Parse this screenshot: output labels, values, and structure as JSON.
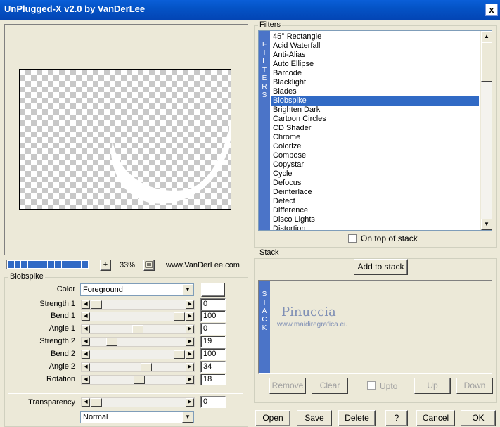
{
  "window": {
    "title": "UnPlugged-X v2.0 by VanDerLee",
    "close_label": "x"
  },
  "preview": {
    "zoom": "33%",
    "website": "www.VanDerLee.com",
    "zoom_in_label": "+",
    "progress_segments": 12
  },
  "filters": {
    "title": "Filters",
    "vertical_tab": [
      "F",
      "I",
      "L",
      "T",
      "E",
      "R",
      "S"
    ],
    "items": [
      "45° Rectangle",
      "Acid Waterfall",
      "Anti-Alias",
      "Auto Ellipse",
      "Barcode",
      "Blacklight",
      "Blades",
      "Blobspike",
      "Brighten Dark",
      "Cartoon Circles",
      "CD Shader",
      "Chrome",
      "Colorize",
      "Compose",
      "Copystar",
      "Cycle",
      "Defocus",
      "Deinterlace",
      "Detect",
      "Difference",
      "Disco Lights",
      "Distortion"
    ],
    "selected": "Blobspike",
    "on_top_label": "On top of stack"
  },
  "stack": {
    "title": "Stack",
    "add_label": "Add to stack",
    "vertical_tab": [
      "S",
      "T",
      "A",
      "C",
      "K"
    ],
    "watermark_name": "Pinuccia",
    "watermark_url": "www.maidiregrafica.eu",
    "remove_label": "Remove",
    "clear_label": "Clear",
    "upto_label": "Upto",
    "up_label": "Up",
    "down_label": "Down"
  },
  "params": {
    "title": "Blobspike",
    "color_label": "Color",
    "color_value": "Foreground",
    "sliders": [
      {
        "label": "Strength 1",
        "value": "0",
        "pos": 0.0
      },
      {
        "label": "Bend 1",
        "value": "100",
        "pos": 1.0
      },
      {
        "label": "Angle 1",
        "value": "0",
        "pos": 0.5
      },
      {
        "label": "Strength 2",
        "value": "19",
        "pos": 0.19
      },
      {
        "label": "Bend 2",
        "value": "100",
        "pos": 1.0
      },
      {
        "label": "Angle 2",
        "value": "34",
        "pos": 0.6
      },
      {
        "label": "Rotation",
        "value": "18",
        "pos": 0.52
      }
    ],
    "transparency_label": "Transparency",
    "transparency_value": "0",
    "transparency_pos": 0.0,
    "blend_mode": "Normal"
  },
  "buttons": {
    "open": "Open",
    "save": "Save",
    "delete": "Delete",
    "help": "?",
    "cancel": "Cancel",
    "ok": "OK"
  },
  "colors": {
    "title_bar": "#0453C6",
    "selection": "#316AC5",
    "vertical_tab": "#4B74C8"
  }
}
